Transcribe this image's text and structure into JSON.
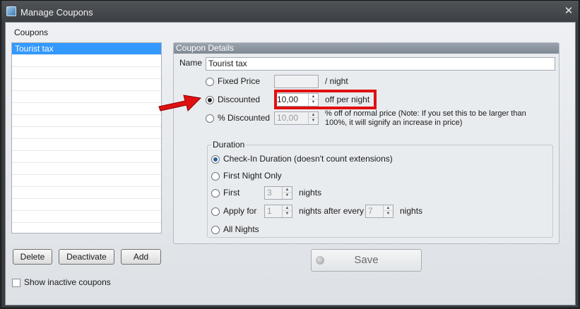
{
  "window": {
    "title": "Manage Coupons",
    "close_glyph": "✕",
    "icon": "app-icon"
  },
  "coupons": {
    "section_label": "Coupons",
    "items": [
      "Tourist tax"
    ],
    "selected_index": 0
  },
  "actions": {
    "delete_label": "Delete",
    "deactivate_label": "Deactivate",
    "add_label": "Add",
    "show_inactive_label": "Show inactive coupons",
    "show_inactive_checked": false
  },
  "details": {
    "group_title": "Coupon Details",
    "name_label": "Name",
    "name_value": "Tourist tax",
    "price_type_selected": "discounted",
    "fixed_price": {
      "label": "Fixed Price",
      "value": "",
      "suffix": "/ night"
    },
    "discounted": {
      "label": "Discounted",
      "value": "10,00",
      "suffix": "off per night"
    },
    "percent_discounted": {
      "label": "% Discounted",
      "value": "10,00",
      "suffix_line1": "% off of normal price (Note: If you set this to be larger than",
      "suffix_line2": "100%, it will signify an increase in price)"
    },
    "duration": {
      "legend": "Duration",
      "selected": "check-in-duration",
      "check_in_label": "Check-In Duration (doesn't count extensions)",
      "first_night_label": "First Night Only",
      "first_label": "First",
      "first_value": "3",
      "first_suffix": "nights",
      "apply_label": "Apply for",
      "apply_value": "1",
      "apply_middle": "nights after every",
      "apply_every_value": "7",
      "apply_suffix": "nights",
      "all_nights_label": "All Nights"
    },
    "save_label": "Save"
  },
  "annotation": {
    "arrow_color": "#e01010",
    "box_color": "#e01010"
  }
}
